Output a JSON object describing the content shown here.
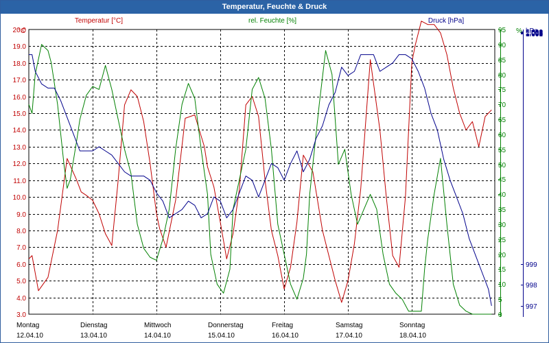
{
  "window": {
    "title": "Temperatur, Feuchte & Druck"
  },
  "colors": {
    "temperature": "#c00000",
    "humidity": "#008000",
    "pressure": "#00008b",
    "grid": "#000000",
    "titlebar": "#2b63a6"
  },
  "chart_data": {
    "type": "line",
    "title": "Temperatur, Feuchte & Druck",
    "grid": true,
    "axes": {
      "left": {
        "label": "Temperatur [°C]",
        "unit": "°C",
        "range": [
          3.0,
          20.0
        ],
        "ticks": [
          "20.0",
          "19.0",
          "18.0",
          "17.0",
          "16.0",
          "15.0",
          "14.0",
          "13.0",
          "12.0",
          "11.0",
          "10.0",
          "9.0",
          "8.0",
          "7.0",
          "6.0",
          "5.0",
          "4.0",
          "3.0"
        ]
      },
      "right1": {
        "label": "rel. Feuchte [%]",
        "unit": "%",
        "range": [
          0,
          95
        ],
        "ticks": [
          "95",
          "90",
          "85",
          "80",
          "75",
          "70",
          "65",
          "60",
          "55",
          "50",
          "45",
          "40",
          "35",
          "30",
          "25",
          "20",
          "15",
          "10",
          "5",
          "0"
        ]
      },
      "right2": {
        "label": "Druck [hPa]",
        "unit": "hPa",
        "range": [
          996.6,
          1010.2
        ],
        "ticks": [
          "1.010",
          "1.009",
          "1.008",
          "1.007",
          "1.006",
          "1.005",
          "1.004",
          "1.003",
          "1.002",
          "1.001",
          "1.000",
          "999",
          "998",
          "997"
        ]
      }
    },
    "x_range": [
      0,
      7.3
    ],
    "x_labels": [
      {
        "day": "Montag",
        "date": "12.04.10"
      },
      {
        "day": "Dienstag",
        "date": "13.04.10"
      },
      {
        "day": "Mittwoch",
        "date": "14.04.10"
      },
      {
        "day": "Donnerstag",
        "date": "15.04.10"
      },
      {
        "day": "Freitag",
        "date": "16.04.10"
      },
      {
        "day": "Samstag",
        "date": "17.04.10"
      },
      {
        "day": "Sonntag",
        "date": "18.04.10"
      }
    ],
    "series": [
      {
        "name": "Temperatur [°C]",
        "axis": "left",
        "x": [
          0.0,
          0.05,
          0.15,
          0.3,
          0.45,
          0.6,
          0.75,
          0.82,
          0.9,
          1.0,
          1.1,
          1.2,
          1.3,
          1.4,
          1.5,
          1.6,
          1.7,
          1.8,
          1.9,
          2.0,
          2.05,
          2.15,
          2.3,
          2.45,
          2.6,
          2.75,
          2.8,
          2.9,
          3.0,
          3.1,
          3.2,
          3.3,
          3.4,
          3.5,
          3.6,
          3.7,
          3.8,
          3.9,
          4.0,
          4.1,
          4.2,
          4.3,
          4.45,
          4.6,
          4.7,
          4.8,
          4.9,
          5.0,
          5.1,
          5.2,
          5.35,
          5.5,
          5.6,
          5.7,
          5.8,
          5.9,
          6.0,
          6.05,
          6.15,
          6.25,
          6.35,
          6.45,
          6.55,
          6.65,
          6.75,
          6.85,
          6.95,
          7.05,
          7.15,
          7.25
        ],
        "values": [
          6.3,
          6.5,
          4.4,
          5.2,
          8.0,
          12.3,
          11.0,
          10.3,
          10.1,
          9.8,
          9.0,
          7.8,
          7.1,
          11.0,
          15.5,
          16.4,
          16.0,
          14.5,
          12.0,
          9.0,
          8.1,
          7.0,
          9.8,
          14.7,
          14.9,
          13.0,
          11.8,
          10.6,
          8.5,
          6.3,
          7.8,
          10.5,
          15.5,
          16.0,
          14.8,
          11.0,
          8.0,
          6.5,
          4.5,
          5.8,
          8.5,
          12.5,
          11.5,
          8.0,
          6.5,
          5.0,
          3.7,
          5.0,
          7.2,
          10.5,
          18.2,
          14.0,
          10.0,
          6.5,
          5.8,
          10.0,
          18.0,
          19.0,
          20.5,
          20.3,
          20.3,
          19.8,
          18.5,
          16.5,
          15.0,
          14.0,
          14.5,
          13.0,
          14.8,
          15.2
        ]
      },
      {
        "name": "rel. Feuchte [%]",
        "axis": "right1",
        "x": [
          0.0,
          0.05,
          0.1,
          0.2,
          0.3,
          0.35,
          0.45,
          0.55,
          0.6,
          0.65,
          0.75,
          0.8,
          0.9,
          1.0,
          1.1,
          1.2,
          1.3,
          1.4,
          1.5,
          1.6,
          1.7,
          1.8,
          1.9,
          2.0,
          2.1,
          2.2,
          2.3,
          2.4,
          2.5,
          2.6,
          2.7,
          2.8,
          2.85,
          2.95,
          3.05,
          3.15,
          3.2,
          3.3,
          3.4,
          3.5,
          3.6,
          3.7,
          3.8,
          3.9,
          4.0,
          4.1,
          4.2,
          4.3,
          4.35,
          4.4,
          4.45,
          4.55,
          4.65,
          4.75,
          4.85,
          4.95,
          5.05,
          5.15,
          5.25,
          5.35,
          5.45,
          5.55,
          5.65,
          5.75,
          5.85,
          5.95,
          6.05,
          6.15,
          6.2,
          6.25,
          6.35,
          6.45,
          6.55,
          6.65,
          6.75,
          6.85,
          6.95,
          7.05,
          7.15,
          7.25
        ],
        "values": [
          70,
          67,
          80,
          90,
          88,
          84,
          70,
          50,
          42,
          45,
          58,
          65,
          73,
          76,
          75,
          83,
          75,
          65,
          55,
          47,
          30,
          22,
          19,
          18,
          25,
          35,
          55,
          70,
          77,
          72,
          55,
          40,
          20,
          10,
          7,
          15,
          35,
          45,
          55,
          75,
          79,
          72,
          55,
          30,
          20,
          10,
          5,
          12,
          20,
          40,
          50,
          70,
          88,
          80,
          50,
          55,
          40,
          30,
          35,
          40,
          35,
          20,
          10,
          7,
          5,
          1,
          1,
          1,
          15,
          25,
          40,
          52,
          30,
          10,
          3,
          1,
          0,
          0,
          0,
          0
        ]
      },
      {
        "name": "Druck [hPa]",
        "axis": "right2",
        "x": [
          0.0,
          0.05,
          0.1,
          0.2,
          0.3,
          0.4,
          0.5,
          0.6,
          0.7,
          0.8,
          0.9,
          1.0,
          1.1,
          1.2,
          1.3,
          1.4,
          1.5,
          1.6,
          1.7,
          1.8,
          1.9,
          2.0,
          2.1,
          2.2,
          2.3,
          2.4,
          2.5,
          2.6,
          2.7,
          2.8,
          2.9,
          3.0,
          3.1,
          3.2,
          3.3,
          3.4,
          3.5,
          3.6,
          3.7,
          3.8,
          3.9,
          4.0,
          4.1,
          4.2,
          4.3,
          4.4,
          4.5,
          4.6,
          4.7,
          4.8,
          4.9,
          5.0,
          5.1,
          5.2,
          5.3,
          5.4,
          5.5,
          5.6,
          5.7,
          5.8,
          5.9,
          6.0,
          6.1,
          6.2,
          6.3,
          6.4,
          6.5,
          6.6,
          6.7,
          6.8,
          6.9,
          7.0,
          7.1,
          7.2,
          7.25
        ],
        "values": [
          1009.0,
          1009.0,
          1008.2,
          1007.6,
          1007.4,
          1007.4,
          1006.8,
          1006.0,
          1005.2,
          1004.4,
          1004.4,
          1004.4,
          1004.6,
          1004.4,
          1004.2,
          1003.8,
          1003.4,
          1003.2,
          1003.2,
          1003.2,
          1003.0,
          1002.4,
          1002.0,
          1001.2,
          1001.4,
          1001.6,
          1002.0,
          1001.8,
          1001.2,
          1001.4,
          1002.2,
          1002.0,
          1001.2,
          1001.6,
          1002.4,
          1003.2,
          1003.0,
          1002.2,
          1003.0,
          1003.8,
          1003.6,
          1003.0,
          1003.8,
          1004.4,
          1003.4,
          1004.0,
          1005.0,
          1005.6,
          1006.6,
          1007.2,
          1008.4,
          1008.0,
          1008.2,
          1009.0,
          1009.0,
          1009.0,
          1008.2,
          1008.4,
          1008.6,
          1009.0,
          1009.0,
          1008.8,
          1008.2,
          1007.4,
          1006.2,
          1005.4,
          1004.0,
          1003.0,
          1002.2,
          1001.4,
          1000.2,
          999.4,
          998.6,
          997.8,
          997.0
        ]
      }
    ]
  }
}
